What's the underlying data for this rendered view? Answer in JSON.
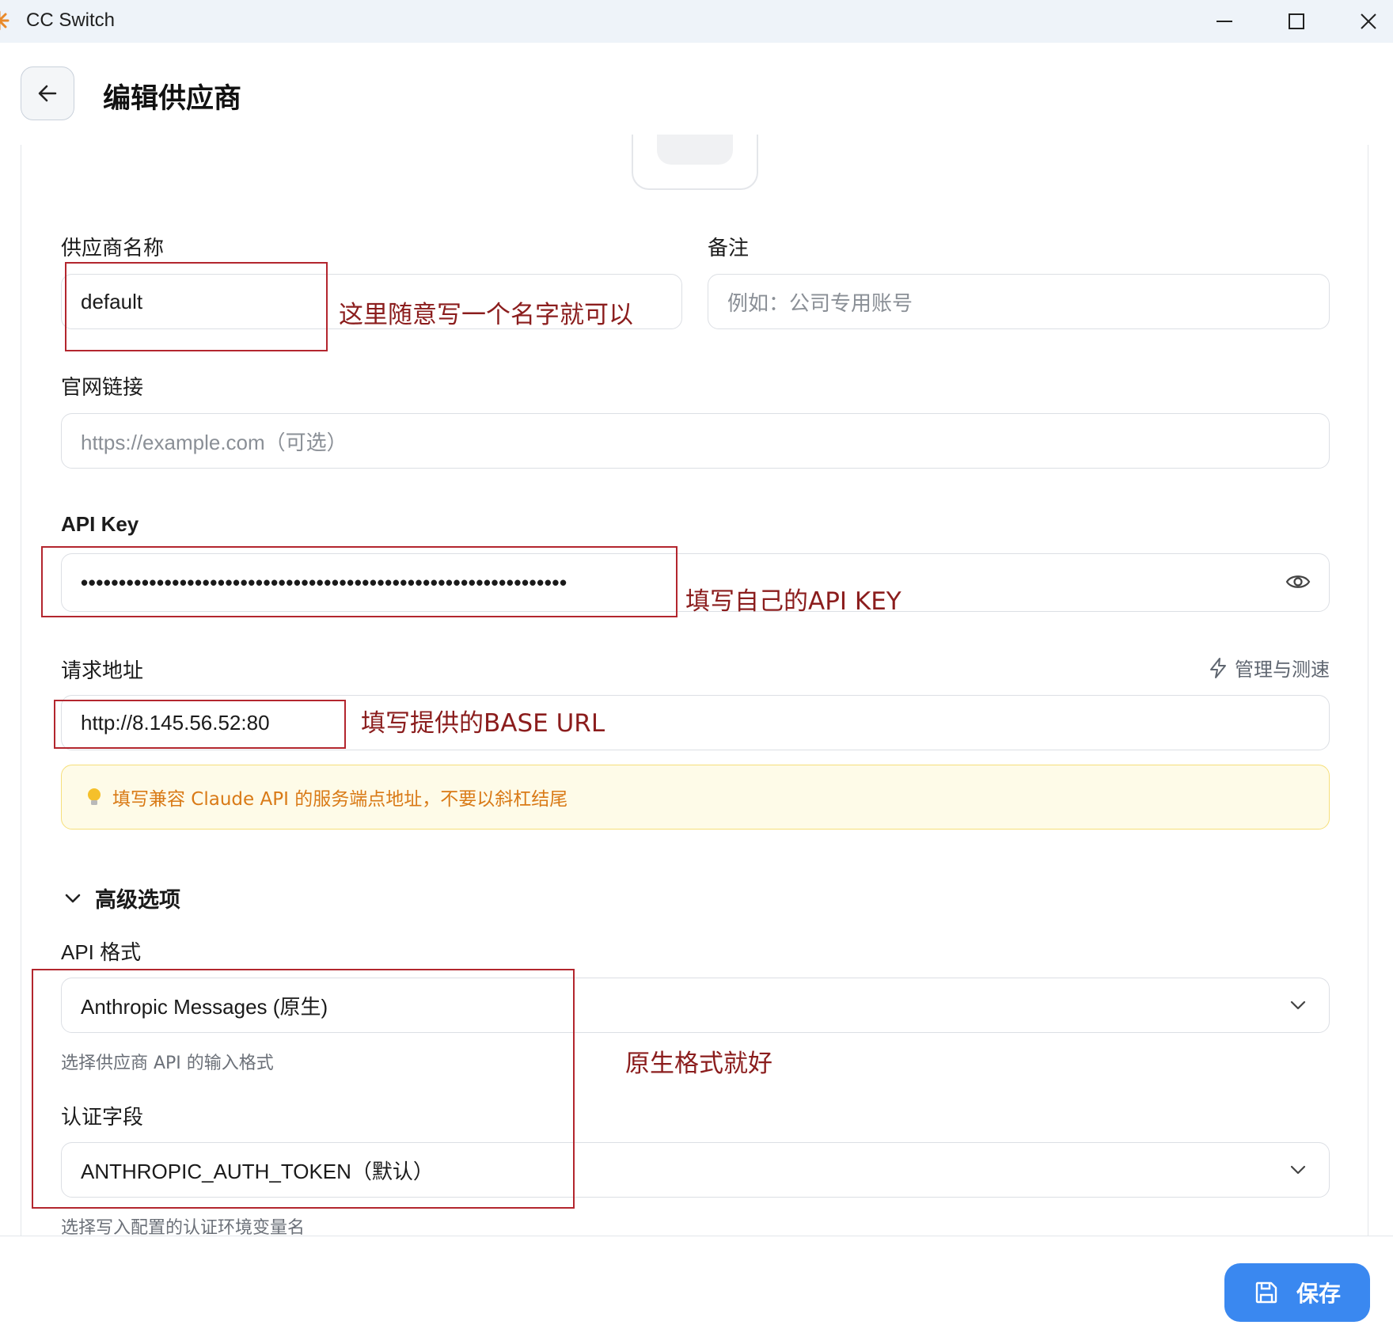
{
  "window": {
    "title": "CC Switch"
  },
  "header": {
    "title": "编辑供应商"
  },
  "form": {
    "provider_name": {
      "label": "供应商名称",
      "value": "default"
    },
    "notes": {
      "label": "备注",
      "placeholder": "例如：公司专用账号"
    },
    "website": {
      "label": "官网链接",
      "placeholder": "https://example.com（可选）"
    },
    "api_key": {
      "label": "API Key",
      "value": "••••••••••••••••••••••••••••••••••••••••••••••••••••••••••••••••"
    },
    "request_url": {
      "label": "请求地址",
      "value": "http://8.145.56.52:80",
      "manage_link": "管理与测速"
    },
    "hint": "填写兼容 Claude API 的服务端点地址，不要以斜杠结尾",
    "advanced": {
      "label": "高级选项"
    },
    "api_format": {
      "label": "API 格式",
      "value": "Anthropic Messages (原生)",
      "help": "选择供应商 API 的输入格式"
    },
    "auth_field": {
      "label": "认证字段",
      "value": "ANTHROPIC_AUTH_TOKEN（默认）",
      "help": "选择写入配置的认证环境变量名"
    }
  },
  "annotations": {
    "name_note": "这里随意写一个名字就可以",
    "key_note": "填写自己的API KEY",
    "url_note": "填写提供的BASE URL",
    "format_note": "原生格式就好"
  },
  "footer": {
    "save_label": "保存"
  },
  "colors": {
    "accent": "#3a88f0",
    "annotation": "#b3262e",
    "hint_text": "#d97a16",
    "hint_bg": "#fefbe8"
  }
}
